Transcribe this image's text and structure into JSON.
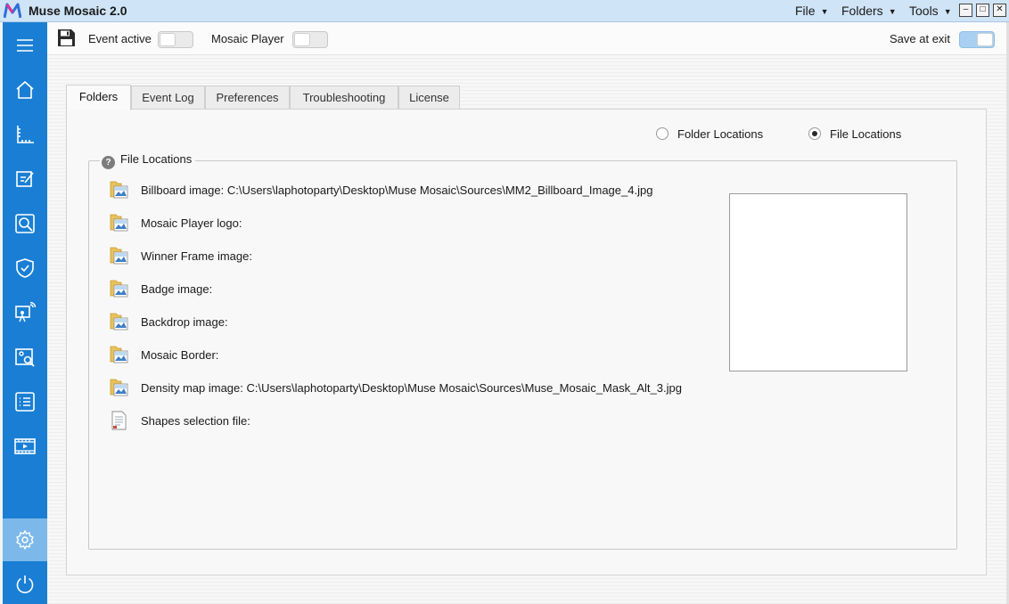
{
  "app": {
    "title": "Muse Mosaic 2.0",
    "logo_letter": "M",
    "accent": "#1a7fd4",
    "title_bar_color": "#cfe4f7"
  },
  "menu": {
    "items": [
      {
        "label": "File"
      },
      {
        "label": "Folders"
      },
      {
        "label": "Tools"
      }
    ]
  },
  "window_controls": {
    "minimize": "–",
    "maximize": "□",
    "close": "✕"
  },
  "sidebar": {
    "items": [
      {
        "icon": "menu-icon"
      },
      {
        "icon": "home-icon"
      },
      {
        "icon": "ruler-icon"
      },
      {
        "icon": "edit-board-icon"
      },
      {
        "icon": "search-icon"
      },
      {
        "icon": "shield-icon"
      },
      {
        "icon": "presentation-icon"
      },
      {
        "icon": "image-search-icon"
      },
      {
        "icon": "checklist-icon"
      },
      {
        "icon": "video-icon"
      },
      {
        "icon": "gear-icon",
        "active": true
      },
      {
        "icon": "power-icon"
      }
    ]
  },
  "toolbar": {
    "save_icon": "floppy-disk-icon",
    "event_active_label": "Event active",
    "event_active_on": false,
    "mosaic_player_label": "Mosaic Player",
    "mosaic_player_on": false,
    "save_at_exit_label": "Save at exit",
    "save_at_exit_on": true
  },
  "tabs": [
    {
      "label": "Folders",
      "active": true
    },
    {
      "label": "Event Log"
    },
    {
      "label": "Preferences"
    },
    {
      "label": "Troubleshooting"
    },
    {
      "label": "License"
    }
  ],
  "view_mode": {
    "options": [
      {
        "label": "Folder Locations",
        "checked": false
      },
      {
        "label": "File Locations",
        "checked": true
      }
    ]
  },
  "file_locations": {
    "group_title": "File Locations",
    "help_glyph": "?",
    "rows": [
      {
        "icon": "folder-image-icon",
        "label": "Billboard image: C:\\Users\\laphotoparty\\Desktop\\Muse Mosaic\\Sources\\MM2_Billboard_Image_4.jpg"
      },
      {
        "icon": "folder-image-icon",
        "label": "Mosaic Player logo:"
      },
      {
        "icon": "folder-image-icon",
        "label": "Winner Frame image:"
      },
      {
        "icon": "folder-image-icon",
        "label": "Badge image:"
      },
      {
        "icon": "folder-image-icon",
        "label": "Backdrop image:"
      },
      {
        "icon": "folder-image-icon",
        "label": "Mosaic Border:"
      },
      {
        "icon": "folder-image-icon",
        "label": "Density map image: C:\\Users\\laphotoparty\\Desktop\\Muse Mosaic\\Sources\\Muse_Mosaic_Mask_Alt_3.jpg"
      },
      {
        "icon": "document-icon",
        "label": "Shapes selection file:"
      }
    ]
  }
}
